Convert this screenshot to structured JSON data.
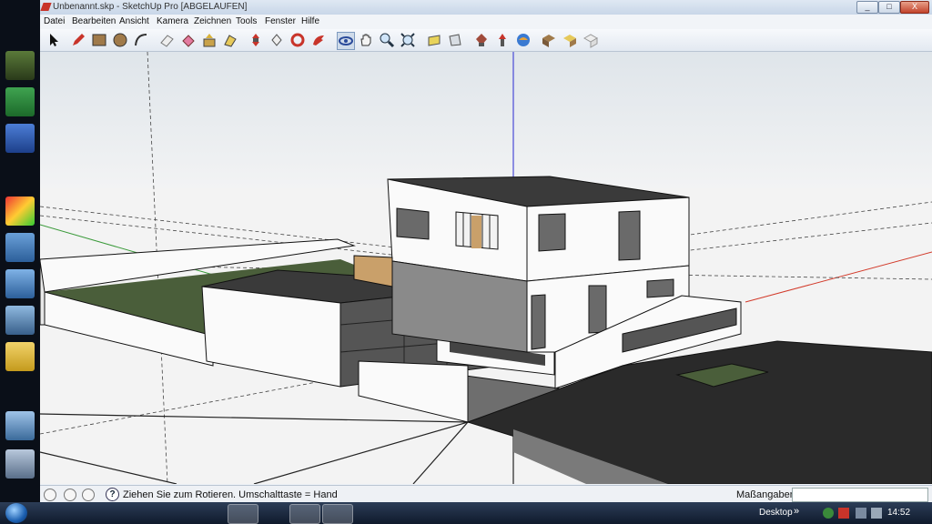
{
  "window": {
    "title": "Unbenannt.skp - SketchUp Pro [ABGELAUFEN]",
    "minimize": "_",
    "maximize": "□",
    "close": "X"
  },
  "menu": [
    "Datei",
    "Bearbeiten",
    "Ansicht",
    "Kamera",
    "Zeichnen",
    "Tools",
    "Fenster",
    "Hilfe"
  ],
  "toolbar": {
    "tools": [
      "select-icon",
      "pencil-icon",
      "rectangle-icon",
      "circle-icon",
      "arc-icon",
      "eraser-icon",
      "paint-bucket-icon",
      "push-pull-icon",
      "follow-me-icon",
      "move-icon",
      "rotate-icon",
      "offset-icon",
      "tape-measure-icon",
      "orbit-icon",
      "pan-icon",
      "zoom-icon",
      "zoom-extents-icon",
      "add-location-icon",
      "toggle-terrain-icon",
      "get-models-icon",
      "share-model-icon",
      "place-model-icon",
      "get-photo-texture-icon",
      "components-icon",
      "warehouse-icon",
      "extension-icon"
    ]
  },
  "status": {
    "hint": "Ziehen Sie zum Rotieren.  Umschalttaste = Hand",
    "help": "?",
    "measure_label": "Maßangaben",
    "measure_value": ""
  },
  "taskbar": {
    "desktop_label": "Desktop",
    "chevron": "»",
    "clock": "14:52"
  },
  "colors": {
    "sky": "#e8ecf0",
    "ground": "#f2f2f2",
    "lawn": "#4a5e3a",
    "roof": "#3a3a3a",
    "axis_red": "#d23a2a",
    "axis_green": "#3a9a3a",
    "axis_blue": "#2a3ad2"
  }
}
